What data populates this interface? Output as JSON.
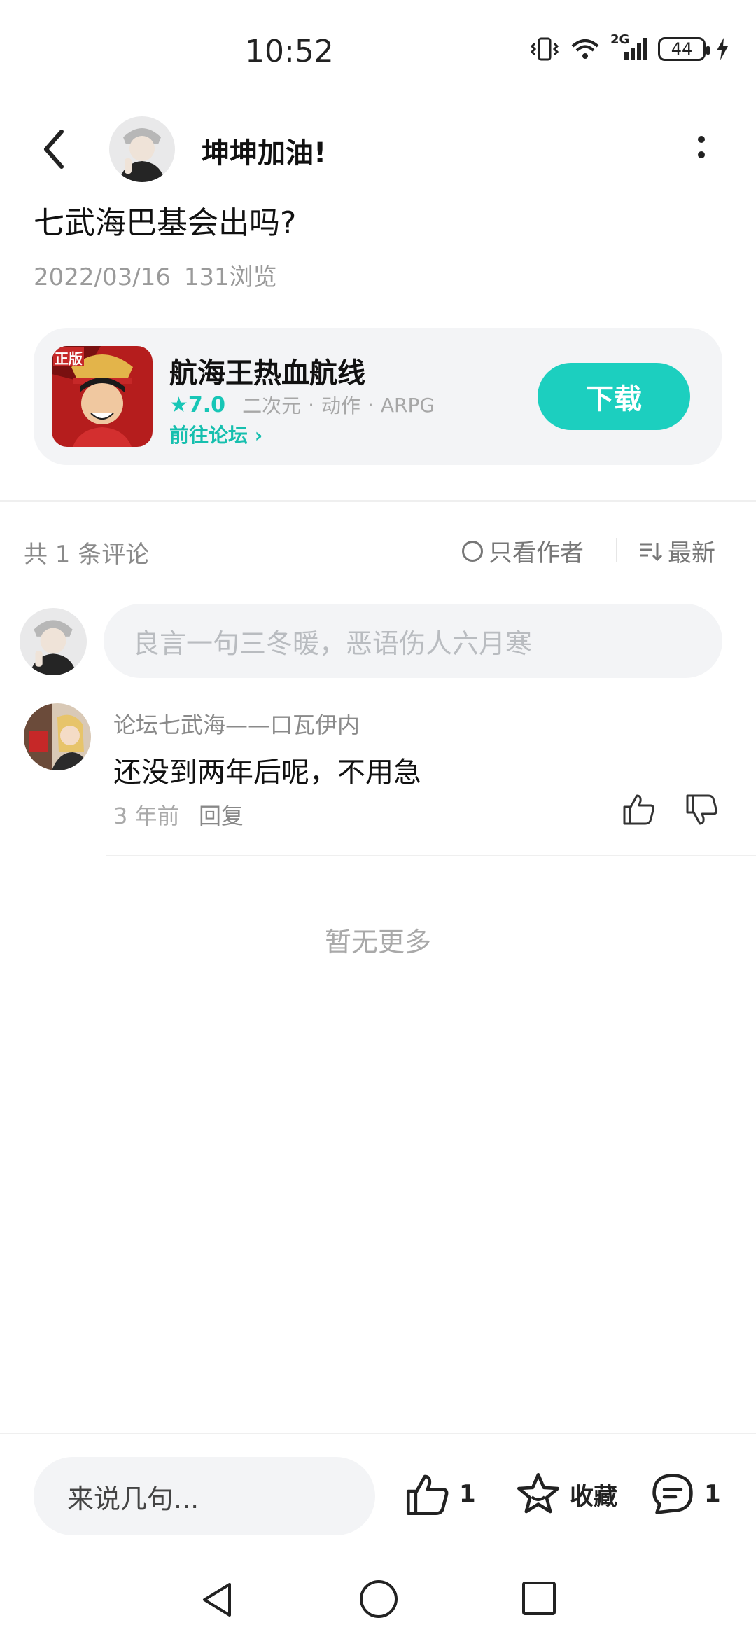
{
  "status_bar": {
    "time": "10:52",
    "network": "2G",
    "battery": "44"
  },
  "header": {
    "username": "坤坤加油!"
  },
  "post": {
    "title": "七武海巴基会出吗?",
    "date": "2022/03/16",
    "views": "131浏览"
  },
  "game_card": {
    "icon_badge": "正版",
    "name": "航海王热血航线",
    "rating": "7.0",
    "tags": [
      "二次元",
      "动作",
      "ARPG"
    ],
    "forum_link": "前往论坛",
    "download_label": "下载"
  },
  "comments_bar": {
    "count_label": "共 1 条评论",
    "author_only_label": "只看作者",
    "sort_label": "最新"
  },
  "comment_input": {
    "placeholder": "良言一句三冬暖，恶语伤人六月寒"
  },
  "comments": [
    {
      "author": "论坛七武海——口瓦伊内",
      "text": "还没到两年后呢，不用急",
      "time": "3 年前",
      "reply_label": "回复"
    }
  ],
  "no_more_label": "暂无更多",
  "bottom_bar": {
    "input_placeholder": "来说几句...",
    "like_count": "1",
    "favorite_label": "收藏",
    "comment_count": "1"
  },
  "colors": {
    "accent": "#1ccfbf",
    "card_bg": "#f3f4f6"
  }
}
